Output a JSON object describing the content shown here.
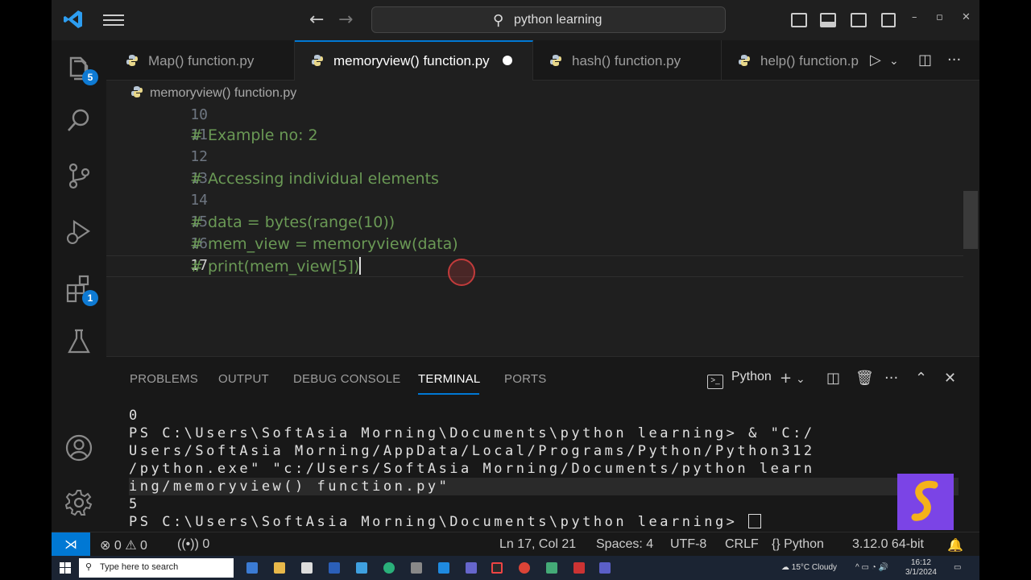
{
  "window": {
    "search_text": "python learning"
  },
  "activity_bar": {
    "explorer_badge": "5",
    "extensions_badge": "1"
  },
  "tabs": [
    {
      "label": "Map() function.py",
      "active": false
    },
    {
      "label": "memoryview() function.py",
      "active": true,
      "modified": true
    },
    {
      "label": "hash() function.py",
      "active": false
    },
    {
      "label": "help() function.p",
      "active": false
    }
  ],
  "breadcrumb": "memoryview() function.py",
  "editor": {
    "lines": [
      {
        "num": "10",
        "code": ""
      },
      {
        "num": "11",
        "code": "# Example no: 2"
      },
      {
        "num": "12",
        "code": ""
      },
      {
        "num": "13",
        "code": "# Accessing individual elements"
      },
      {
        "num": "14",
        "code": ""
      },
      {
        "num": "15",
        "code": "# data = bytes(range(10))"
      },
      {
        "num": "16",
        "code": "# mem_view = memoryview(data)"
      },
      {
        "num": "17",
        "code": "# print(mem_view[5])"
      }
    ],
    "current_line": "17"
  },
  "panel": {
    "tabs": [
      "PROBLEMS",
      "OUTPUT",
      "DEBUG CONSOLE",
      "TERMINAL",
      "PORTS"
    ],
    "active_tab": "TERMINAL",
    "shell": "Python",
    "terminal_lines": [
      "0",
      "PS C:\\Users\\SoftAsia Morning\\Documents\\python learning> & \"C:/",
      "Users/SoftAsia Morning/AppData/Local/Programs/Python/Python312",
      "/python.exe\" \"c:/Users/SoftAsia Morning/Documents/python learn",
      "ing/memoryview() function.py\"",
      "5",
      "PS C:\\Users\\SoftAsia Morning\\Documents\\python learning> "
    ]
  },
  "status_bar": {
    "errors": "0",
    "warnings": "0",
    "ports": "0",
    "position": "Ln 17, Col 21",
    "spaces": "Spaces: 4",
    "encoding": "UTF-8",
    "eol": "CRLF",
    "language": "Python",
    "interpreter": "3.12.0 64-bit"
  },
  "taskbar": {
    "search_placeholder": "Type here to search",
    "weather": "15°C Cloudy",
    "time": "16:12",
    "date": "3/1/2024"
  }
}
